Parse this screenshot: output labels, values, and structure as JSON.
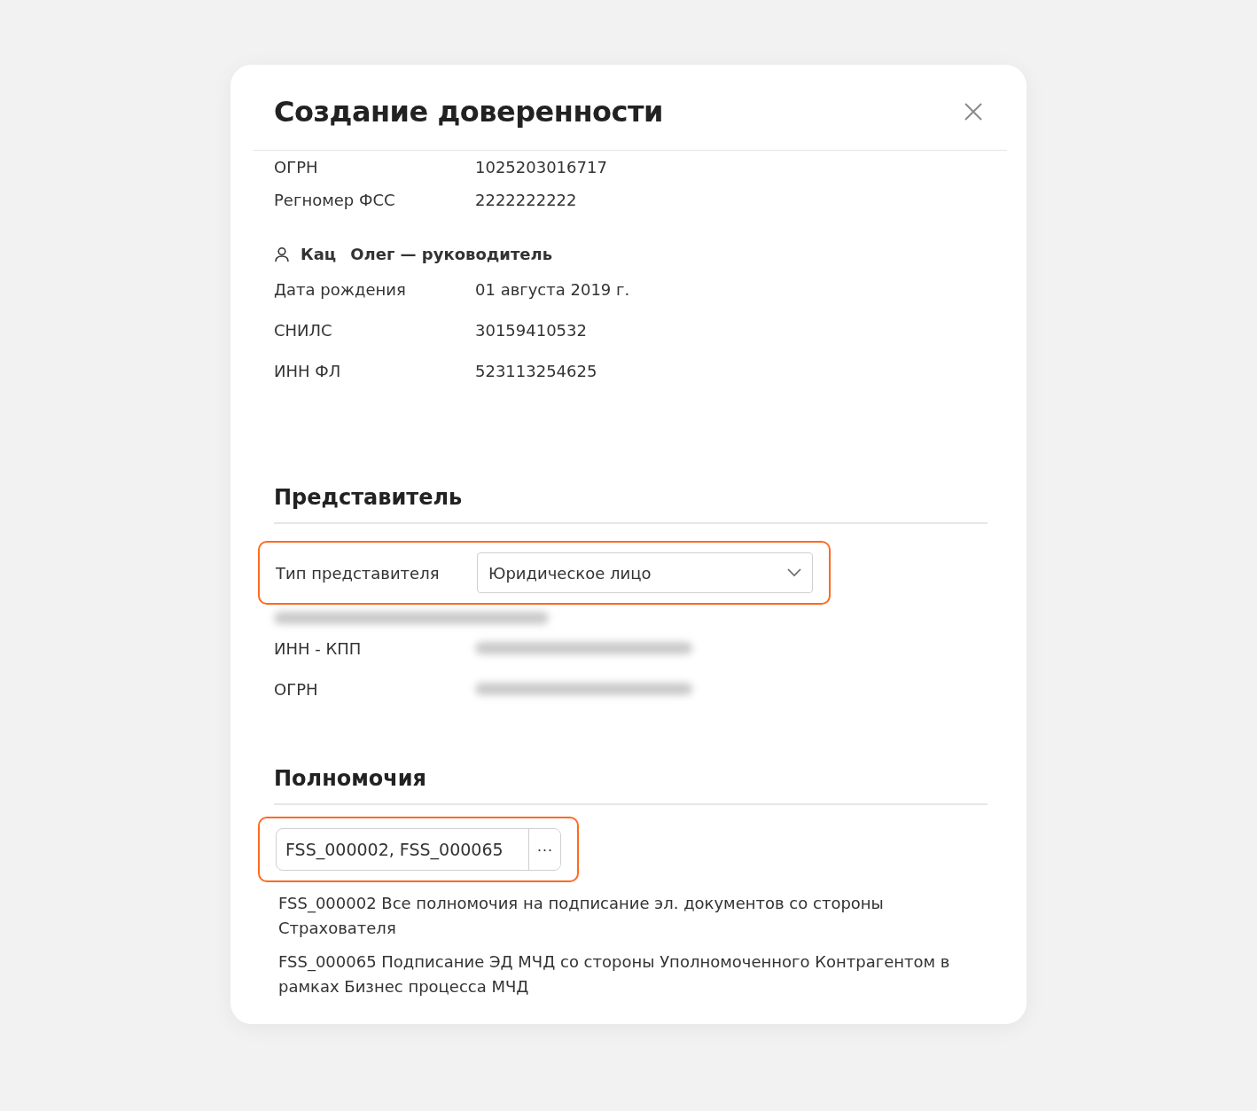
{
  "dialog": {
    "title": "Создание доверенности"
  },
  "org_rows": [
    {
      "label": "ОГРН",
      "value": "1025203016717"
    },
    {
      "label": "Регномер ФСС",
      "value": "2222222222"
    }
  ],
  "person": {
    "surname": "Кац",
    "name_role": "Олег — руководитель",
    "rows": [
      {
        "label": "Дата рождения",
        "value": "01 августа 2019 г."
      },
      {
        "label": "СНИЛС",
        "value": "30159410532"
      },
      {
        "label": "ИНН ФЛ",
        "value": "523113254625"
      }
    ]
  },
  "representative": {
    "title": "Представитель",
    "type_label": "Тип представителя",
    "type_value": "Юридическое лицо",
    "highlighted": true,
    "rows": [
      {
        "label": "ИНН - КПП",
        "redacted": true
      },
      {
        "label": "ОГРН",
        "redacted": true
      }
    ]
  },
  "powers": {
    "title": "Полномочия",
    "value": "FSS_000002, FSS_000065",
    "more_label": "···",
    "highlighted": true,
    "items": [
      {
        "code": "FSS_000002",
        "text": "Все полномочия на подписание эл. документов со стороны Страхователя"
      },
      {
        "code": "FSS_000065",
        "text": "Подписание ЭД МЧД со стороны Уполномоченного Контрагентом в рамках Бизнес процесса МЧД"
      }
    ]
  }
}
